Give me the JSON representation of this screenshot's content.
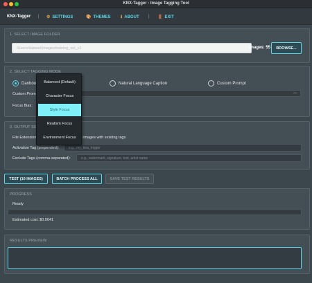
{
  "window": {
    "title": "KNX-Tagger - Image Tagging Tool"
  },
  "menu": {
    "app_name": "KNX-Tagger",
    "separator": "|",
    "items": [
      {
        "label": "SETTINGS",
        "icon": "gear-icon",
        "glyph": "⚙"
      },
      {
        "label": "THEMES",
        "icon": "palette-icon",
        "glyph": "🎨"
      },
      {
        "label": "ABOUT",
        "icon": "info-icon",
        "glyph": "ℹ"
      },
      {
        "label": "EXIT",
        "icon": "door-icon",
        "glyph": "🚪"
      }
    ]
  },
  "folder_section": {
    "title": "1. SELECT IMAGE FOLDER",
    "path_value": "/Users/dataset/images/training_set_v1",
    "images_count_label": "Images: 55",
    "browse_label": "BROWSE..."
  },
  "mode_section": {
    "title": "2. SELECT TAGGING MODE",
    "modes": [
      {
        "label": "Danbooru Tags",
        "selected": true
      },
      {
        "label": "Natural Language Caption",
        "selected": false
      },
      {
        "label": "Custom Prompt",
        "selected": false
      }
    ],
    "custom_prompt_label": "Custom Prompt:",
    "focus_bias_label": "Focus Bias:",
    "focus_options": [
      "Balanced (Default)",
      "Character Focus",
      "Style Focus",
      "Realism Focus",
      "Environment Focus"
    ],
    "focus_selected_index": 2
  },
  "output_section": {
    "title": "3. OUTPUT SETTINGS",
    "file_extension_label": "File Extension:",
    "skip_existing_label": "Skip images with existing tags",
    "activation_label": "Activation Tag (prepended):",
    "activation_placeholder": "e.g., my_lora_trigger",
    "exclude_label": "Exclude Tags (comma-separated):",
    "exclude_placeholder": "e.g., watermark, signature, text, artist name"
  },
  "actions": {
    "test_label": "TEST (10 IMAGES)",
    "batch_label": "BATCH PROCESS ALL",
    "save_label": "SAVE TEST RESULTS"
  },
  "progress": {
    "title": "PROGRESS",
    "status": "Ready",
    "fraction": 0,
    "cost_label": "Estimated cost: $0.0041"
  },
  "results": {
    "title": "RESULTS PREVIEW"
  },
  "colors": {
    "accent": "#5dd6e6",
    "background": "#3c464d",
    "panel": "#434e55",
    "dropdown_highlight": "#7ff0f7"
  }
}
